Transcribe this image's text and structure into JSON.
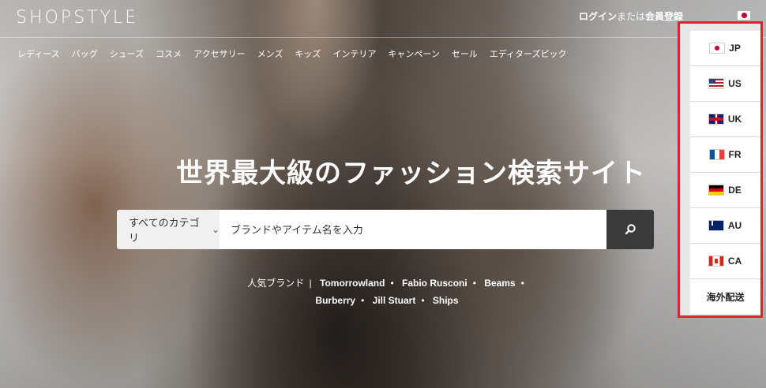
{
  "header": {
    "logo": "SHOPSTYLE",
    "login_text": "ログイン",
    "or_text": "または",
    "register_text": "会員登録"
  },
  "nav": {
    "items": [
      "レディース",
      "バッグ",
      "シューズ",
      "コスメ",
      "アクセサリー",
      "メンズ",
      "キッズ",
      "インテリア",
      "キャンペーン",
      "セール",
      "エディターズピック"
    ]
  },
  "hero": {
    "headline": "世界最大級のファッション検索サイト"
  },
  "search": {
    "category_label": "すべてのカテゴリ",
    "placeholder": "ブランドやアイテム名を入力"
  },
  "popular": {
    "label": "人気ブランド",
    "brands": [
      "Tomorrowland",
      "Fabio Rusconi",
      "Beams",
      "Burberry",
      "Jill Stuart",
      "Ships"
    ]
  },
  "country_menu": {
    "items": [
      {
        "code": "JP",
        "flag": "jp"
      },
      {
        "code": "US",
        "flag": "us"
      },
      {
        "code": "UK",
        "flag": "uk"
      },
      {
        "code": "FR",
        "flag": "fr"
      },
      {
        "code": "DE",
        "flag": "de"
      },
      {
        "code": "AU",
        "flag": "au"
      },
      {
        "code": "CA",
        "flag": "ca"
      }
    ],
    "overseas_label": "海外配送"
  },
  "colors": {
    "highlight_border": "#e4202b",
    "search_button": "#3a3a3a"
  }
}
